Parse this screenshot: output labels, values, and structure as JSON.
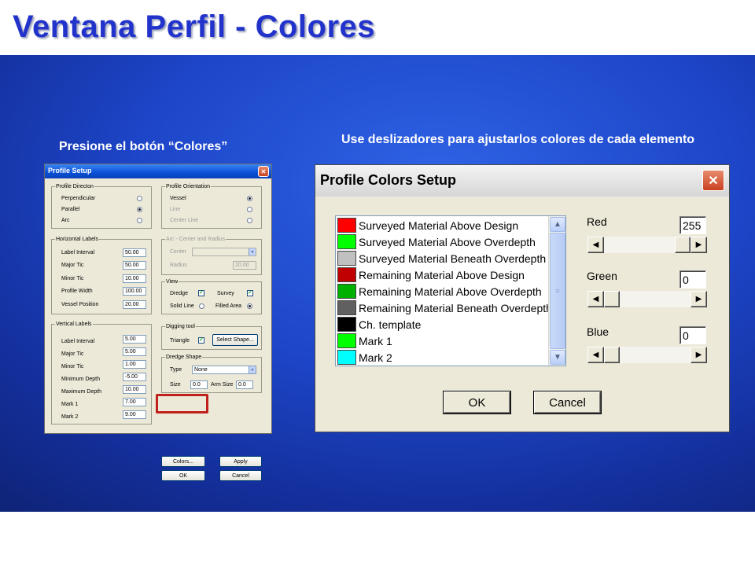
{
  "slide": {
    "title": "Ventana Perfil - Colores",
    "caption_left": "Presione el botón “Colores”",
    "caption_right": "Use deslizadores para ajustarlos colores de cada elemento"
  },
  "profile_setup": {
    "title": "Profile Setup",
    "close": "✕",
    "profile_direction": {
      "label": "Profile Directon",
      "options": [
        {
          "label": "Perpendicular",
          "selected": false
        },
        {
          "label": "Parallel",
          "selected": true
        },
        {
          "label": "Arc",
          "selected": false
        }
      ]
    },
    "profile_orientation": {
      "label": "Profile Orientation",
      "options": [
        {
          "label": "Vessel",
          "selected": true
        },
        {
          "label": "Line",
          "selected": false
        },
        {
          "label": "Center Line",
          "selected": false
        }
      ]
    },
    "horizontal_labels": {
      "label": "Horizontal Labels",
      "fields": [
        {
          "label": "Label Interval",
          "value": "50.00"
        },
        {
          "label": "Major Tic",
          "value": "50.00"
        },
        {
          "label": "Minor Tic",
          "value": "10.00"
        },
        {
          "label": "Profile Width",
          "value": "100.00"
        },
        {
          "label": "Vessel Position",
          "value": "20.00"
        }
      ]
    },
    "arc": {
      "label": "Arc - Center and Radius",
      "center_label": "Center",
      "center_value": "",
      "radius_label": "Radius",
      "radius_value": "20.00"
    },
    "view": {
      "label": "View",
      "dredge": "Dredge",
      "survey": "Survey",
      "solid_line": "Solid Line",
      "filled_area": "Filled Area",
      "check_mark": "✓"
    },
    "vertical_labels": {
      "label": "Vertical Labels",
      "fields": [
        {
          "label": "Label Interval",
          "value": "5.00"
        },
        {
          "label": "Major Tic",
          "value": "5.00"
        },
        {
          "label": "Minor Tic",
          "value": "1.00"
        },
        {
          "label": "Minimum Depth",
          "value": "-5.00"
        },
        {
          "label": "Maximum Depth",
          "value": "10.00"
        },
        {
          "label": "Mark 1",
          "value": "7.00"
        },
        {
          "label": "Mark 2",
          "value": "9.00"
        }
      ]
    },
    "digging_tool": {
      "label": "Digging tool",
      "triangle": "Triangle",
      "select_shape": "Select Shape..."
    },
    "dredge_shape": {
      "label": "Dredge Shape",
      "type_label": "Type",
      "type_value": "None",
      "size_label": "Size",
      "size_value": "0.0",
      "arm_size_label": "Arm Size",
      "arm_size_value": "0.0"
    },
    "buttons": {
      "colors": "Colors...",
      "apply": "Apply",
      "ok": "OK",
      "cancel": "Cancel"
    }
  },
  "colors_setup": {
    "title": "Profile Colors Setup",
    "close": "✕",
    "items": [
      {
        "label": "Surveyed Material Above Design",
        "color": "#ff0000"
      },
      {
        "label": "Surveyed Material Above Overdepth",
        "color": "#00ff00"
      },
      {
        "label": "Surveyed Material Beneath Overdepth",
        "color": "#c0c0c0"
      },
      {
        "label": "Remaining Material Above Design",
        "color": "#c00000"
      },
      {
        "label": "Remaining Material Above Overdepth",
        "color": "#00b000"
      },
      {
        "label": "Remaining Material Beneath Overdepth",
        "color": "#606060"
      },
      {
        "label": "Ch. template",
        "color": "#000000"
      },
      {
        "label": "Mark 1",
        "color": "#00ff00"
      },
      {
        "label": "Mark 2",
        "color": "#00ffff"
      }
    ],
    "red": {
      "label": "Red",
      "value": "255",
      "level": 1.0
    },
    "green": {
      "label": "Green",
      "value": "0",
      "level": 0.0
    },
    "blue": {
      "label": "Blue",
      "value": "0",
      "level": 0.0
    },
    "buttons": {
      "ok": "OK",
      "cancel": "Cancel"
    },
    "icons": {
      "up": "▲",
      "down": "▼",
      "left": "◀",
      "right": "▶",
      "grip": "≡"
    }
  }
}
